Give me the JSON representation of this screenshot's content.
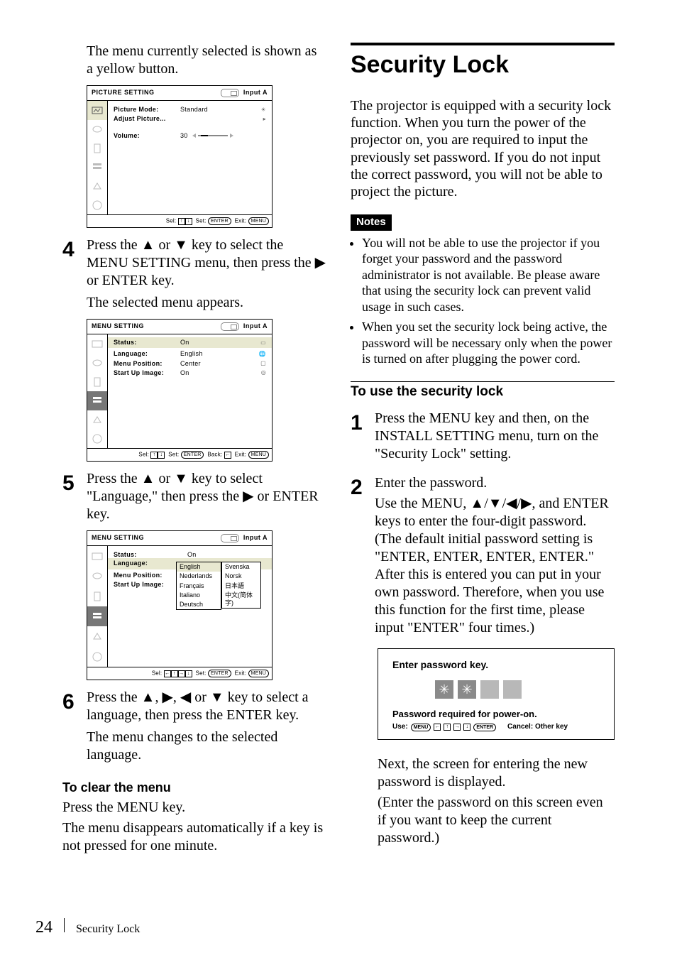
{
  "left": {
    "intro": "The menu currently selected is shown as a yellow button.",
    "fig1": {
      "title": "PICTURE SETTING",
      "source_label": "Input A",
      "rows": [
        {
          "lbl": "Picture Mode:",
          "val": "Standard",
          "ind": "☀"
        },
        {
          "lbl": "Adjust Picture...",
          "val": "",
          "ind": "▸"
        }
      ],
      "volume_label": "Volume:",
      "volume_value": "30",
      "footer": "Sel:      Set:          Exit:"
    },
    "step4": {
      "num": "4",
      "lead": "Press the ▲ or ▼ key to select the MENU SETTING menu, then press the ▶ or ENTER key.",
      "sub": "The selected menu appears."
    },
    "fig2": {
      "title": "MENU SETTING",
      "source_label": "Input A",
      "hl": {
        "lbl": "Status:",
        "val": "On"
      },
      "rows": [
        {
          "lbl": "Language:",
          "val": "English",
          "ind": "🌐"
        },
        {
          "lbl": "Menu Position:",
          "val": "Center",
          "ind": "▢"
        },
        {
          "lbl": "Start Up Image:",
          "val": "On",
          "ind": "◎"
        }
      ],
      "footer": "Sel:      Set:          Back:      Exit:"
    },
    "step5": {
      "num": "5",
      "lead": "Press the ▲ or ▼ key to select \"Language,\" then press the ▶ or ENTER key."
    },
    "fig3": {
      "title": "MENU SETTING",
      "source_label": "Input A",
      "status": {
        "lbl": "Status:",
        "val": "On"
      },
      "hl": {
        "lbl": "Language:",
        "val": "English"
      },
      "rows": [
        {
          "lbl": "Menu Position:",
          "val": "Nederlands"
        },
        {
          "lbl": "Start Up Image:",
          "val": "Français"
        }
      ],
      "opts_left": [
        "English",
        "Nederlands",
        "Français",
        "Italiano",
        "Deutsch"
      ],
      "opts_right": [
        "Svenska",
        "Norsk",
        "日本語",
        "中文(简体字)"
      ],
      "footer": "Sel:            Set:          Exit:"
    },
    "step6": {
      "num": "6",
      "lead": "Press the ▲, ▶, ◀ or ▼ key to select a language, then press the ENTER key.",
      "sub": "The menu changes to the selected language."
    },
    "clear_head": "To clear the menu",
    "clear_p1": "Press the MENU key.",
    "clear_p2": "The menu disappears automatically if a key is not pressed for one minute.",
    "btn_enter": "ENTER",
    "btn_menu": "MENU",
    "arrow_up": "↑",
    "arrow_down": "↓",
    "arrow_left": "←",
    "arrow_right": "→"
  },
  "right": {
    "h1": "Security Lock",
    "para1": "The projector is equipped with a security lock function. When you turn the power of the projector on, you are required to input the previously set password. If you do not input the correct password, you will not be able to project the picture.",
    "notes_label": "Notes",
    "notes": [
      "You will not be able to use the projector if you forget your password and the password administrator is not available. Be please aware that using the security lock can prevent valid usage in such cases.",
      "When you set the security lock being active, the password will be necessary only when the power is turned on after plugging the power cord."
    ],
    "sub_title": "To use the security lock",
    "step1": {
      "num": "1",
      "lead": "Press the MENU key and then, on the INSTALL SETTING menu, turn on the \"Security Lock\" setting."
    },
    "step2": {
      "num": "2",
      "lead": "Enter the password.",
      "body": "Use the MENU, ▲/▼/◀/▶, and ENTER keys to enter the four-digit password. (The default initial password setting is \"ENTER, ENTER, ENTER, ENTER.\" After this is entered you can put in your own password. Therefore, when you use this function for the first time, please input \"ENTER\" four times.)"
    },
    "pwdlg": {
      "t1": "Enter password key.",
      "star": "✳",
      "t2": "Password required for power-on.",
      "use_label": "Use:",
      "btn_menu": "MENU",
      "btn_enter": "ENTER",
      "cancel": "Cancel: Other key"
    },
    "after": "Next, the screen for entering the new password is displayed.",
    "after2": "(Enter the password on this screen even if you want to keep the current password.)"
  },
  "footer": {
    "page": "24",
    "title": "Security Lock"
  }
}
